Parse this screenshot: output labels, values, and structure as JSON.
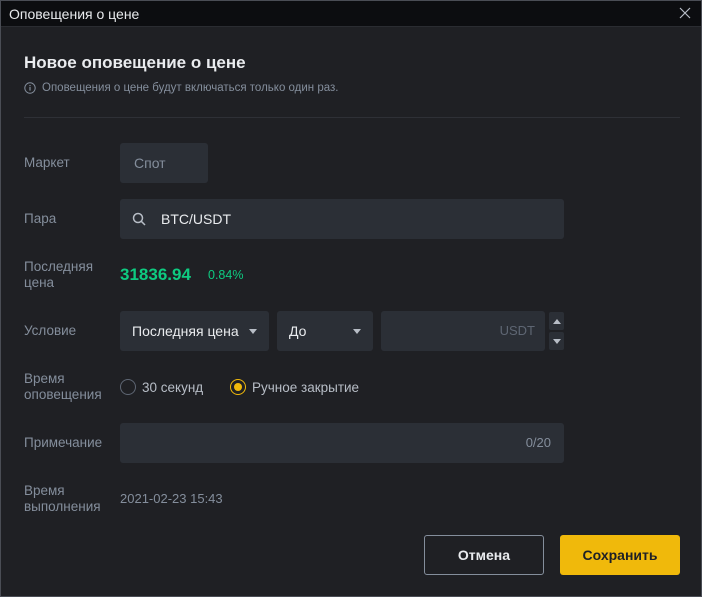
{
  "window": {
    "title": "Оповещения о цене",
    "close_icon": "close-icon"
  },
  "dialog": {
    "heading": "Новое оповещение о цене",
    "info": "Оповещения о цене будут включаться только один раз."
  },
  "form": {
    "market": {
      "label": "Маркет",
      "value": "Спот"
    },
    "pair": {
      "label": "Пара",
      "value": "BTC/USDT",
      "icon": "search-icon"
    },
    "last_price": {
      "label": "Последняя цена",
      "price": "31836.94",
      "change": "0.84%",
      "color": "#0ecb81"
    },
    "condition": {
      "label": "Условие",
      "type_selected": "Последняя цена",
      "direction_selected": "До",
      "unit": "USDT"
    },
    "alert_time": {
      "label": "Время оповещения",
      "options": [
        {
          "label": "30 секунд",
          "selected": false
        },
        {
          "label": "Ручное закрытие",
          "selected": true
        }
      ]
    },
    "note": {
      "label": "Примечание",
      "counter": "0/20"
    },
    "exec_time": {
      "label": "Время выполнения",
      "value": "2021-02-23 15:43"
    }
  },
  "buttons": {
    "cancel": "Отмена",
    "save": "Сохранить"
  },
  "colors": {
    "accent": "#f0b90b",
    "positive": "#0ecb81",
    "background": "#1f2024"
  }
}
